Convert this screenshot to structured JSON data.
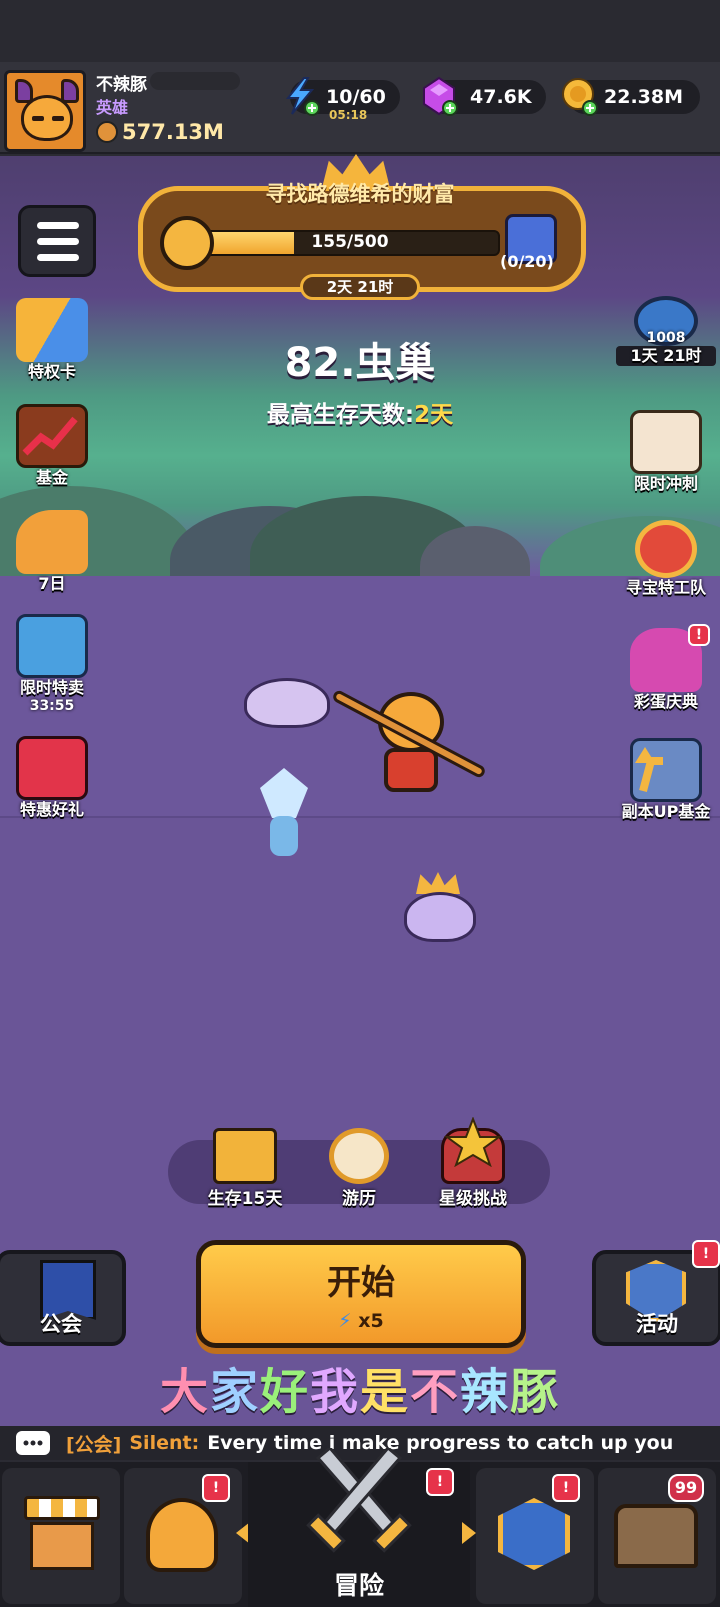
{
  "player": {
    "name": "不辣豚",
    "title": "英雄",
    "power": "577.13M"
  },
  "resources": {
    "energy": {
      "value": "10/60",
      "timer": "05:18"
    },
    "gems": {
      "value": "47.6K"
    },
    "gold": {
      "value": "22.38M"
    }
  },
  "quest": {
    "title": "寻找路德维希的财富",
    "progress_text": "155/500",
    "progress": 0.31,
    "reward_count": "(0/20)",
    "timer": "2天 21时"
  },
  "stage": {
    "name": "82.虫巢",
    "best_label": "最高生存天数:",
    "best_value": "2天"
  },
  "left_menu": [
    {
      "label": "特权卡",
      "sub": ""
    },
    {
      "label": "基金",
      "sub": ""
    },
    {
      "label": "7日",
      "sub": ""
    },
    {
      "label": "限时特卖",
      "sub": "33:55"
    },
    {
      "label": "特惠好礼",
      "sub": ""
    }
  ],
  "right_menu": [
    {
      "label": "1天 21时",
      "badge": "1008"
    },
    {
      "label": "限时冲刺"
    },
    {
      "label": "寻宝特工队"
    },
    {
      "label": "彩蛋庆典"
    },
    {
      "label": "副本UP基金"
    }
  ],
  "modes": [
    {
      "label": "生存15天"
    },
    {
      "label": "游历"
    },
    {
      "label": "星级挑战"
    }
  ],
  "start": {
    "label": "开始",
    "cost": "x5"
  },
  "guild_button": {
    "label": "公会"
  },
  "events_button": {
    "label": "活动"
  },
  "subtitle": {
    "chars": [
      "大",
      "家",
      "好",
      "我",
      "是",
      "不",
      "辣",
      "豚"
    ],
    "colors": [
      "#ff8fb0",
      "#9fd0ff",
      "#9af07a",
      "#e0a8ff",
      "#ffe066",
      "#ff9fc0",
      "#a8e6ff",
      "#b6f28a"
    ]
  },
  "chat": {
    "channel": "[公会]",
    "sender": "Silent:",
    "message": "Every time i make progress to catch up you"
  },
  "nav": {
    "center_label": "冒险",
    "chest_badge": "99",
    "alert": "!"
  },
  "colors": {
    "accent": "#f2992a",
    "gold_frame": "#f1b23a",
    "purple_bg": "#6a5593",
    "alert_red": "#e6334a"
  }
}
